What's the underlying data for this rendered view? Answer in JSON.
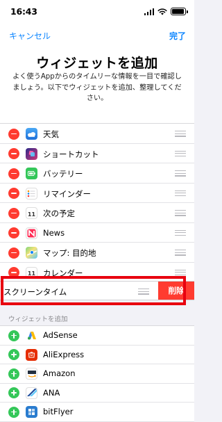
{
  "status_bar": {
    "time": "16:43"
  },
  "nav": {
    "cancel_label": "キャンセル",
    "done_label": "完了"
  },
  "header": {
    "title": "ウィジェットを追加",
    "description_lines": [
      "よく使うAppからのタイムリーな情報を一目で確認し",
      "ましょう。以下でウィジェットを追加、整理してくだ",
      "さい。"
    ]
  },
  "current_widgets": [
    {
      "label": "天気",
      "icon": "weather-icon",
      "icon_color": "#1e88e5"
    },
    {
      "label": "ショートカット",
      "icon": "shortcuts-icon",
      "icon_color": "#3a3ad6"
    },
    {
      "label": "バッテリー",
      "icon": "battery-widget-icon",
      "icon_color": "#34c759"
    },
    {
      "label": "リマインダー",
      "icon": "reminders-icon",
      "icon_color": "#ffffff"
    },
    {
      "label": "次の予定",
      "icon": "calendar-icon",
      "icon_text": "11",
      "icon_color": "#ffffff"
    },
    {
      "label": "News",
      "icon": "news-icon",
      "icon_color": "#ff2d55"
    },
    {
      "label": "マップ: 目的地",
      "icon": "maps-icon",
      "icon_color": "#62c370"
    },
    {
      "label": "カレンダー",
      "icon": "calendar-icon",
      "icon_text": "11",
      "icon_color": "#ffffff"
    }
  ],
  "selected_widget": {
    "label": "スクリーンタイム",
    "delete_label": "削除"
  },
  "available_section": {
    "header": "ウィジェットを追加",
    "items": [
      {
        "label": "AdSense",
        "icon": "adsense-icon",
        "icon_color": "#fbbc04"
      },
      {
        "label": "AliExpress",
        "icon": "aliexpress-icon",
        "icon_color": "#e62e04"
      },
      {
        "label": "Amazon",
        "icon": "amazon-icon",
        "icon_color": "#232f3e"
      },
      {
        "label": "ANA",
        "icon": "ana-icon",
        "icon_color": "#1a4b9c"
      },
      {
        "label": "bitFlyer",
        "icon": "bitflyer-icon",
        "icon_color": "#2a7ccf"
      }
    ]
  }
}
